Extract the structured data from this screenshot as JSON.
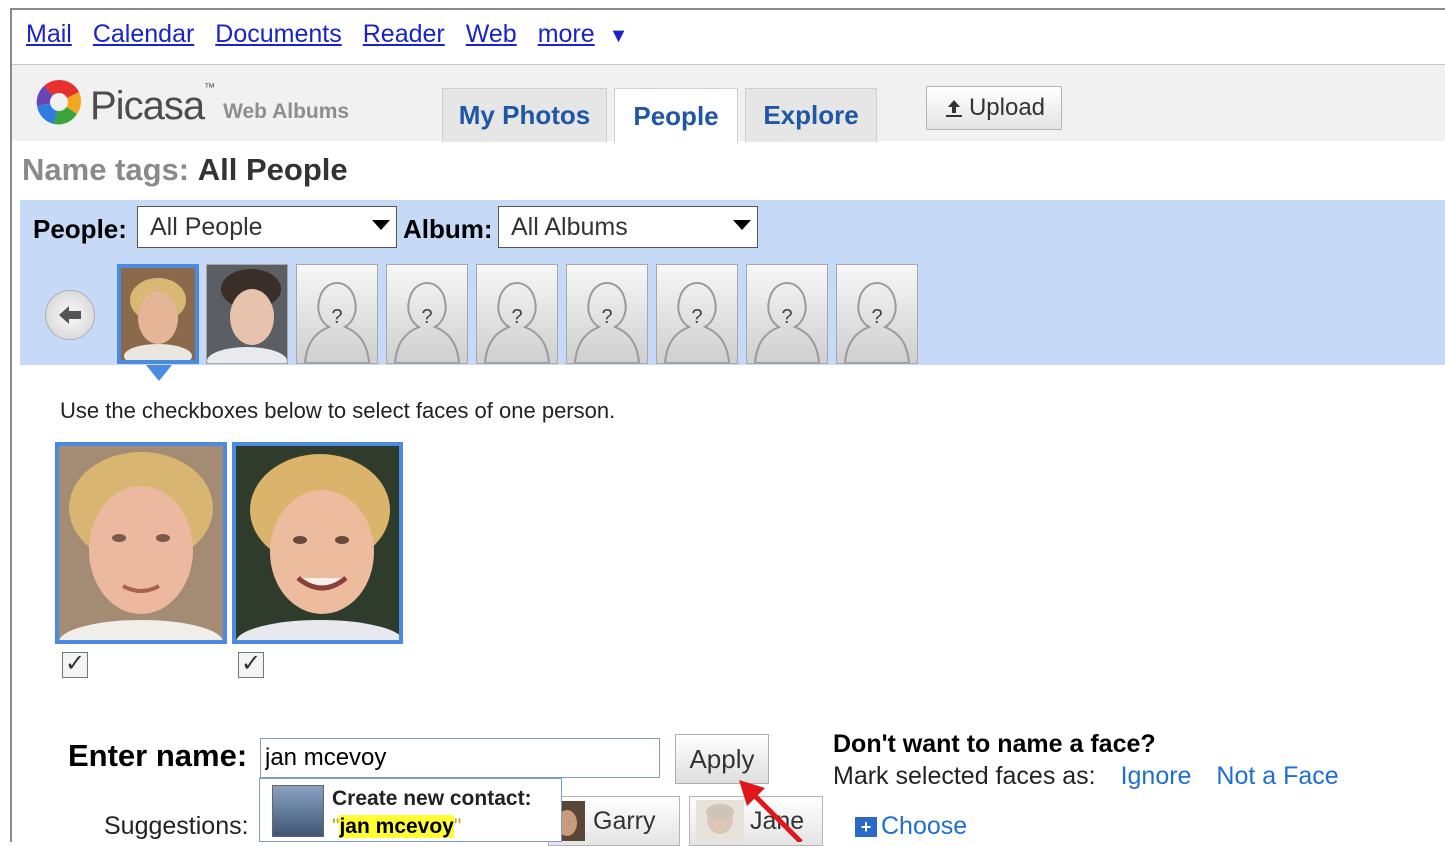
{
  "top_links": [
    "Mail",
    "Calendar",
    "Documents",
    "Reader",
    "Web",
    "more"
  ],
  "top_more_arrow": "▼",
  "logo": {
    "name": "Picasa",
    "tm": "™",
    "sub": "Web Albums"
  },
  "tabs": [
    {
      "label": "My Photos",
      "active": false
    },
    {
      "label": "People",
      "active": true
    },
    {
      "label": "Explore",
      "active": false
    }
  ],
  "upload_label": "Upload",
  "upload_icon": "upload-arrow-icon",
  "page_title": {
    "prefix": "Name tags:",
    "value": "All People"
  },
  "filters": {
    "people_label": "People:",
    "people_value": "All People",
    "album_label": "Album:",
    "album_value": "All Albums"
  },
  "unknown_glyph": "?",
  "instruction": "Use the checkboxes below to select faces of one person.",
  "checkbox_glyph": "✓",
  "enter_name": {
    "label": "Enter name:",
    "value": "jan mcevoy"
  },
  "apply_label": "Apply",
  "dont_want": {
    "title": "Don't want to name a face?",
    "mark_as": "Mark selected faces as:",
    "ignore": "Ignore",
    "not_face": "Not a Face"
  },
  "suggestions": {
    "label": "Suggestions:",
    "items": [
      "Garry",
      "Jane"
    ],
    "choose": "Choose"
  },
  "autocomplete": {
    "title": "Create new contact:",
    "name_open": "\"",
    "name": "jan mcevoy",
    "name_close": "\""
  },
  "colors": {
    "link": "#1a22c9",
    "panel": "#c6d9f7",
    "selection": "#4a8be0",
    "annotation_arrow": "#e0161b"
  }
}
